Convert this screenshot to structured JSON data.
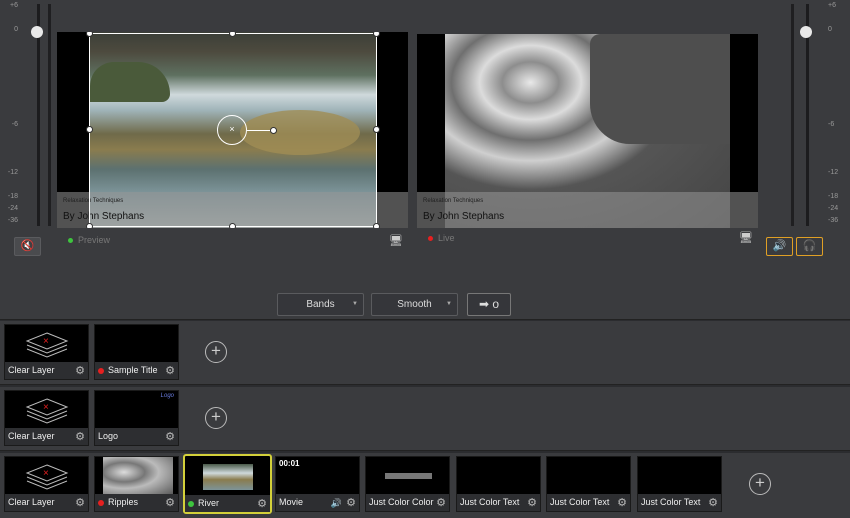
{
  "meters": {
    "left_ticks": [
      "+6",
      "0",
      "-6",
      "-12",
      "-18",
      "-24",
      "-36"
    ],
    "right_ticks": [
      "+6",
      "0",
      "-6",
      "-12",
      "-18",
      "-24",
      "-36"
    ]
  },
  "preview": {
    "status_label": "Preview",
    "lower_third_small": "Relaxation Techniques",
    "lower_third_name": "By John Stephans"
  },
  "live": {
    "status_label": "Live",
    "lower_third_small": "Relaxation Techniques",
    "lower_third_name": "By John Stephans"
  },
  "transition": {
    "type": "Bands",
    "easing": "Smooth",
    "go_symbol": "➡ o"
  },
  "icons": {
    "mute": "🔇",
    "speaker": "🔊",
    "headphones": "🎧",
    "monitor": "🖥",
    "gear": "⚙",
    "add": "+"
  },
  "layers": [
    {
      "tiles": [
        {
          "label": "Clear Layer",
          "status": "none"
        },
        {
          "label": "Sample Title",
          "status": "live"
        }
      ]
    },
    {
      "tiles": [
        {
          "label": "Clear Layer",
          "status": "none"
        },
        {
          "label": "Logo",
          "status": "none",
          "thumb_text": "Logo"
        }
      ]
    },
    {
      "tiles": [
        {
          "label": "Clear Layer",
          "status": "none"
        },
        {
          "label": "Ripples",
          "status": "live"
        },
        {
          "label": "River",
          "status": "preview"
        },
        {
          "label": "Movie",
          "status": "none",
          "time": "00:01"
        },
        {
          "label": "Just Color Color",
          "status": "none"
        },
        {
          "label": "Just Color Text",
          "status": "none"
        },
        {
          "label": "Just Color Text",
          "status": "none"
        },
        {
          "label": "Just Color Text",
          "status": "none"
        }
      ]
    }
  ]
}
